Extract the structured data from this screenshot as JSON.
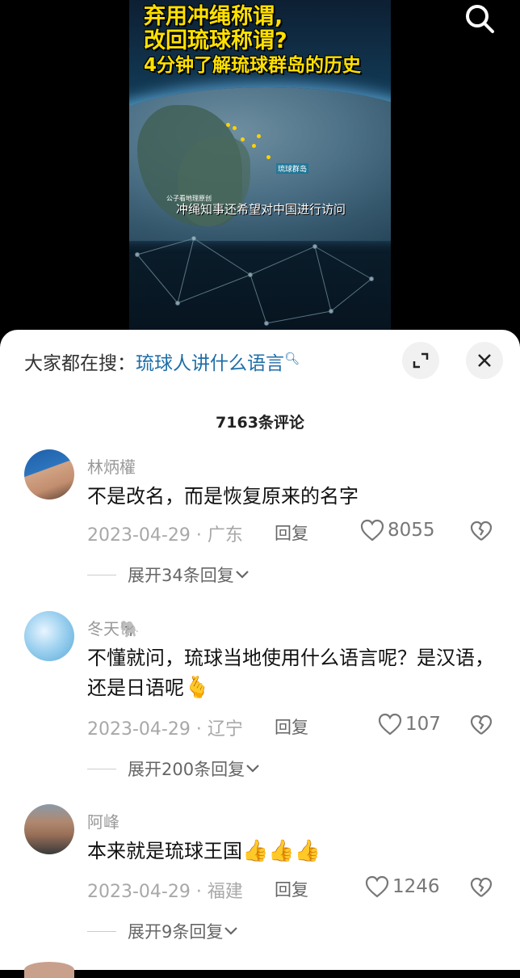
{
  "video": {
    "title_lines": [
      "弃用冲绳称谓,",
      "改回琉球称谓?",
      "4分钟了解琉球群岛的历史"
    ],
    "map_label": "琉球群岛",
    "credit": "公子看地理原创",
    "subtitle": "冲绳知事还希望对中国进行访问",
    "search_icon": "search-icon"
  },
  "sheet": {
    "hot_search_prefix": "大家都在搜：",
    "hot_search_query": "琉球人讲什么语言",
    "comment_count": "7163条评论",
    "expand_icon": "expand-icon",
    "close_icon": "close-icon"
  },
  "comments": [
    {
      "name": "林炳權",
      "text": "不是改名，而是恢复原来的名字",
      "date_loc": "2023-04-29 · 广东",
      "reply_label": "回复",
      "likes": "8055",
      "expand": "展开34条回复"
    },
    {
      "name": "冬天🐘",
      "text": "不懂就问，琉球当地使用什么语言呢？是汉语，还是日语呢",
      "emoji": "🫰",
      "date_loc": "2023-04-29 · 辽宁",
      "reply_label": "回复",
      "likes": "107",
      "expand": "展开200条回复"
    },
    {
      "name": "阿峰",
      "text": "本来就是琉球王国",
      "emoji": "👍👍👍",
      "date_loc": "2023-04-29 · 福建",
      "reply_label": "回复",
      "likes": "1246",
      "expand": "展开9条回复"
    }
  ]
}
